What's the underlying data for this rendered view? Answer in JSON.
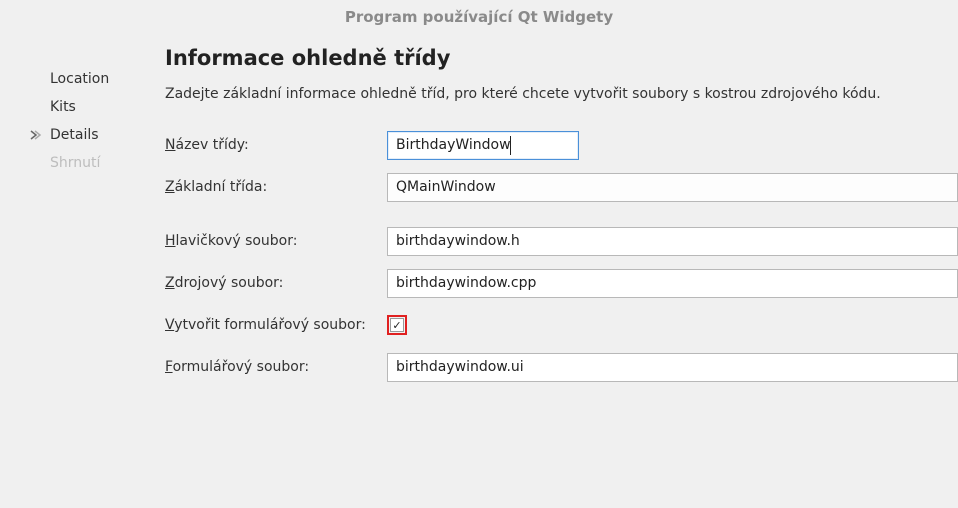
{
  "window": {
    "title": "Program používající Qt Widgety"
  },
  "sidebar": {
    "items": [
      {
        "label": "Location",
        "state": "done"
      },
      {
        "label": "Kits",
        "state": "done"
      },
      {
        "label": "Details",
        "state": "active"
      },
      {
        "label": "Shrnutí",
        "state": "disabled"
      }
    ]
  },
  "page": {
    "title": "Informace ohledně třídy",
    "description": "Zadejte základní informace ohledně tříd, pro které chcete vytvořit soubory s kostrou zdrojového kódu."
  },
  "form": {
    "class_name": {
      "label_pre": "N",
      "label_rest": "ázev třídy:",
      "value": "BirthdayWindow"
    },
    "base_class": {
      "label_pre": "Z",
      "label_rest": "ákladní třída:",
      "value": "QMainWindow"
    },
    "header_file": {
      "label_pre": "H",
      "label_rest": "lavičkový soubor:",
      "value": "birthdaywindow.h"
    },
    "source_file": {
      "label_pre": "Z",
      "label_rest": "drojový soubor:",
      "value": "birthdaywindow.cpp"
    },
    "gen_form": {
      "label_pre": "V",
      "label_rest": "ytvořit formulářový soubor:",
      "checked": true,
      "checkmark": "✓"
    },
    "form_file": {
      "label_pre": "F",
      "label_rest": "ormulářový soubor:",
      "value": "birthdaywindow.ui"
    }
  }
}
